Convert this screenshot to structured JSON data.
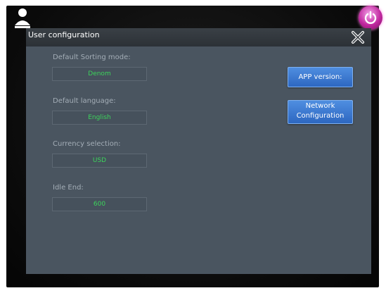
{
  "window": {
    "title": "User configuration"
  },
  "fields": [
    {
      "label": "Default Sorting mode:",
      "value": "Denom"
    },
    {
      "label": "Default language:",
      "value": "English"
    },
    {
      "label": "Currency selection:",
      "value": "USD"
    },
    {
      "label": "Idle End:",
      "value": "600"
    }
  ],
  "buttons": {
    "app_version": "APP version:",
    "network_line1": "Network",
    "network_line2": "Configuration"
  },
  "icons": {
    "user": "user-icon",
    "power": "power-icon",
    "close": "close-icon"
  },
  "colors": {
    "value_text": "#3cd45b",
    "button_blue": "#2d67c1",
    "power_accent": "#c0279f"
  }
}
